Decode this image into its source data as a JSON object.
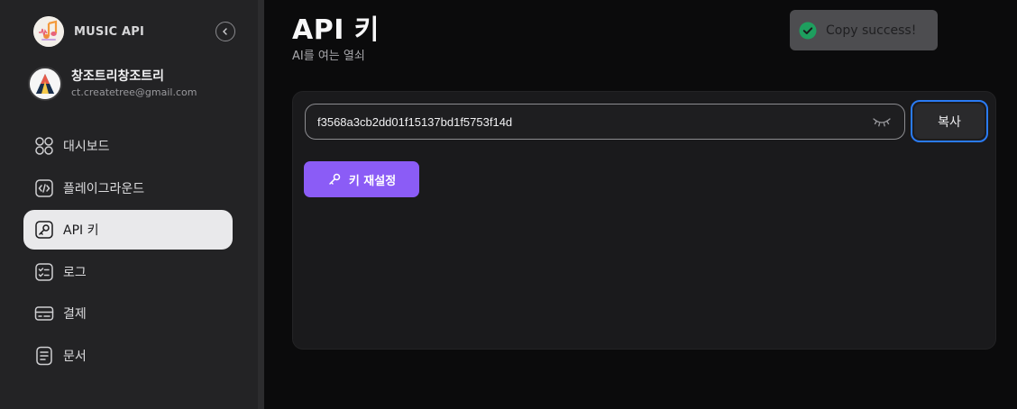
{
  "brand": {
    "name": "MUSIC API",
    "logo_icon": "music-note-logo-icon",
    "collapse_icon": "chevron-left-icon"
  },
  "profile": {
    "name": "창조트리창조트리",
    "email": "ct.createtree@gmail.com"
  },
  "sidebar": {
    "items": [
      {
        "label": "대시보드",
        "icon": "dashboard-grid-icon",
        "active": false
      },
      {
        "label": "플레이그라운드",
        "icon": "code-icon",
        "active": false
      },
      {
        "label": "API 키",
        "icon": "key-icon",
        "active": true
      },
      {
        "label": "로그",
        "icon": "checklist-icon",
        "active": false
      },
      {
        "label": "결제",
        "icon": "card-icon",
        "active": false
      },
      {
        "label": "문서",
        "icon": "document-icon",
        "active": false
      }
    ]
  },
  "main": {
    "title": "API 키",
    "subtitle": "AI를 여는 열쇠",
    "api_key": "f3568a3cb2dd01f15137bd1f5753f14d",
    "copy_label": "복사",
    "reset_label": "키 재설정"
  },
  "toast": {
    "text": "Copy success!",
    "icon": "check-circle-icon"
  },
  "colors": {
    "accent_purple": "#8b5cf6",
    "focus_blue": "#2a7bf4",
    "success_green": "#1e9e5e"
  }
}
